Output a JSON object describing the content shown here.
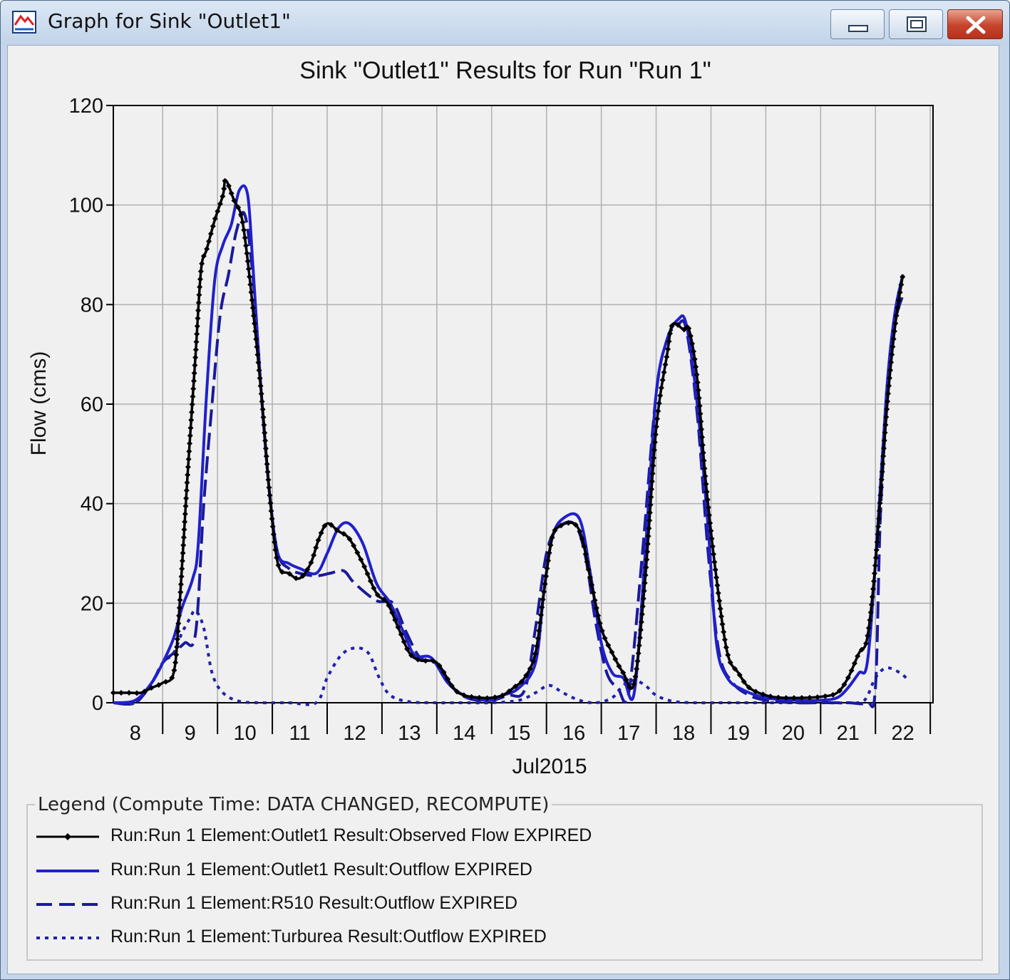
{
  "window": {
    "title": "Graph for Sink \"Outlet1\"",
    "icon": "hec-hms-app-icon",
    "controls": [
      "minimize-icon",
      "maximize-icon",
      "close-icon"
    ],
    "colors": {
      "close": "#c5432c",
      "frame": "#c5d6ea"
    }
  },
  "chart_data": {
    "type": "line",
    "title": "Sink \"Outlet1\" Results for Run \"Run 1\"",
    "xlabel": "Jul2015",
    "ylabel": "Flow (cms)",
    "xlim": [
      7.6,
      22.55
    ],
    "ylim": [
      0,
      120
    ],
    "yticks": [
      0,
      20,
      40,
      60,
      80,
      100,
      120
    ],
    "xtick_labels": [
      "8",
      "9",
      "10",
      "11",
      "12",
      "13",
      "14",
      "15",
      "16",
      "17",
      "18",
      "19",
      "20",
      "21",
      "22"
    ],
    "x_unit": "day of July 2015",
    "grid": true,
    "legend_placement": "bottom",
    "series": [
      {
        "name": "Run:Run 1 Element:Outlet1 Result:Observed Flow EXPIRED",
        "color": "#000000",
        "style": "solid-markers",
        "points": [
          [
            7.6,
            2
          ],
          [
            7.9,
            2
          ],
          [
            8.1,
            2
          ],
          [
            8.3,
            3
          ],
          [
            8.5,
            4
          ],
          [
            8.7,
            6
          ],
          [
            8.8,
            18
          ],
          [
            8.95,
            45
          ],
          [
            9.1,
            70
          ],
          [
            9.2,
            87
          ],
          [
            9.3,
            91
          ],
          [
            9.45,
            97
          ],
          [
            9.6,
            102
          ],
          [
            9.65,
            105
          ],
          [
            9.8,
            101
          ],
          [
            9.95,
            97
          ],
          [
            10.1,
            84
          ],
          [
            10.3,
            62
          ],
          [
            10.45,
            42
          ],
          [
            10.6,
            28
          ],
          [
            10.8,
            26
          ],
          [
            11.0,
            25
          ],
          [
            11.2,
            28
          ],
          [
            11.35,
            33
          ],
          [
            11.5,
            36
          ],
          [
            11.7,
            34.5
          ],
          [
            11.9,
            33
          ],
          [
            12.15,
            28
          ],
          [
            12.4,
            22
          ],
          [
            12.6,
            20
          ],
          [
            12.8,
            15
          ],
          [
            13.0,
            10
          ],
          [
            13.2,
            8.5
          ],
          [
            13.5,
            8
          ],
          [
            13.8,
            3
          ],
          [
            14.0,
            1.5
          ],
          [
            14.3,
            1
          ],
          [
            14.5,
            1
          ],
          [
            14.7,
            1.5
          ],
          [
            14.9,
            3
          ],
          [
            15.1,
            5
          ],
          [
            15.3,
            10
          ],
          [
            15.45,
            22
          ],
          [
            15.6,
            33
          ],
          [
            15.75,
            35.5
          ],
          [
            16.0,
            36
          ],
          [
            16.15,
            33
          ],
          [
            16.3,
            25
          ],
          [
            16.5,
            15
          ],
          [
            16.7,
            10
          ],
          [
            16.9,
            6
          ],
          [
            17.1,
            4
          ],
          [
            17.3,
            25
          ],
          [
            17.5,
            55
          ],
          [
            17.7,
            70
          ],
          [
            17.8,
            76
          ],
          [
            18.0,
            75
          ],
          [
            18.1,
            75
          ],
          [
            18.25,
            65
          ],
          [
            18.4,
            45
          ],
          [
            18.6,
            25
          ],
          [
            18.8,
            10
          ],
          [
            19.0,
            6
          ],
          [
            19.2,
            3
          ],
          [
            19.5,
            1.5
          ],
          [
            19.8,
            1
          ],
          [
            20.2,
            1
          ],
          [
            20.5,
            1.2
          ],
          [
            20.8,
            2
          ],
          [
            21.0,
            5
          ],
          [
            21.2,
            10
          ],
          [
            21.35,
            13
          ],
          [
            21.5,
            28
          ],
          [
            21.7,
            58
          ],
          [
            21.85,
            75
          ],
          [
            22.0,
            86
          ]
        ]
      },
      {
        "name": "Run:Run 1 Element:Outlet1 Result:Outflow EXPIRED",
        "color": "#2020cc",
        "style": "solid",
        "points": [
          [
            7.6,
            0
          ],
          [
            8.0,
            0.5
          ],
          [
            8.3,
            4
          ],
          [
            8.5,
            8
          ],
          [
            8.7,
            13
          ],
          [
            8.85,
            19
          ],
          [
            9.05,
            25
          ],
          [
            9.15,
            32
          ],
          [
            9.3,
            62
          ],
          [
            9.45,
            85
          ],
          [
            9.6,
            92
          ],
          [
            9.75,
            96
          ],
          [
            9.9,
            103
          ],
          [
            10.05,
            102
          ],
          [
            10.15,
            87
          ],
          [
            10.3,
            62
          ],
          [
            10.45,
            42
          ],
          [
            10.6,
            30
          ],
          [
            10.8,
            28
          ],
          [
            11.0,
            27
          ],
          [
            11.3,
            26
          ],
          [
            11.5,
            30
          ],
          [
            11.7,
            35
          ],
          [
            11.9,
            36
          ],
          [
            12.15,
            32
          ],
          [
            12.4,
            24
          ],
          [
            12.65,
            20
          ],
          [
            12.9,
            14
          ],
          [
            13.1,
            9.5
          ],
          [
            13.4,
            9
          ],
          [
            13.7,
            4
          ],
          [
            14.0,
            1.5
          ],
          [
            14.4,
            0.5
          ],
          [
            14.7,
            1.5
          ],
          [
            15.0,
            3
          ],
          [
            15.3,
            8
          ],
          [
            15.45,
            22
          ],
          [
            15.6,
            33
          ],
          [
            15.8,
            37
          ],
          [
            16.1,
            37
          ],
          [
            16.3,
            26
          ],
          [
            16.5,
            12
          ],
          [
            16.7,
            6
          ],
          [
            16.9,
            5
          ],
          [
            17.1,
            2
          ],
          [
            17.3,
            30
          ],
          [
            17.5,
            62
          ],
          [
            17.7,
            73
          ],
          [
            17.9,
            77
          ],
          [
            18.05,
            76
          ],
          [
            18.25,
            60
          ],
          [
            18.45,
            35
          ],
          [
            18.6,
            12
          ],
          [
            18.8,
            5
          ],
          [
            19.1,
            2.5
          ],
          [
            19.5,
            1
          ],
          [
            20.0,
            0.5
          ],
          [
            20.5,
            0.5
          ],
          [
            20.8,
            1
          ],
          [
            21.0,
            3
          ],
          [
            21.2,
            6
          ],
          [
            21.35,
            8
          ],
          [
            21.5,
            28
          ],
          [
            21.7,
            62
          ],
          [
            21.85,
            78
          ],
          [
            22.0,
            86
          ]
        ]
      },
      {
        "name": "Run:Run 1 Element:R510 Result:Outflow EXPIRED",
        "color": "#1a1a9a",
        "style": "dashed",
        "points": [
          [
            7.6,
            0
          ],
          [
            8.0,
            0
          ],
          [
            8.3,
            4
          ],
          [
            8.5,
            8
          ],
          [
            8.7,
            10
          ],
          [
            8.9,
            12
          ],
          [
            9.1,
            14
          ],
          [
            9.25,
            40
          ],
          [
            9.4,
            60
          ],
          [
            9.55,
            78
          ],
          [
            9.7,
            86
          ],
          [
            9.85,
            95
          ],
          [
            10.0,
            98
          ],
          [
            10.15,
            85
          ],
          [
            10.3,
            62
          ],
          [
            10.45,
            42
          ],
          [
            10.6,
            30
          ],
          [
            10.8,
            27
          ],
          [
            11.0,
            26
          ],
          [
            11.3,
            25.5
          ],
          [
            11.55,
            26
          ],
          [
            11.8,
            26.5
          ],
          [
            12.0,
            24
          ],
          [
            12.4,
            20.5
          ],
          [
            12.7,
            20
          ],
          [
            12.95,
            14
          ],
          [
            13.2,
            9
          ],
          [
            13.5,
            8
          ],
          [
            13.8,
            3
          ],
          [
            14.1,
            0.8
          ],
          [
            14.5,
            0.5
          ],
          [
            14.8,
            1.5
          ],
          [
            15.1,
            2.5
          ],
          [
            15.3,
            15
          ],
          [
            15.5,
            30
          ],
          [
            15.7,
            35
          ],
          [
            16.0,
            36
          ],
          [
            16.2,
            30
          ],
          [
            16.4,
            16
          ],
          [
            16.6,
            6
          ],
          [
            16.8,
            3
          ],
          [
            17.0,
            2
          ],
          [
            17.25,
            30
          ],
          [
            17.5,
            62
          ],
          [
            17.7,
            73
          ],
          [
            17.9,
            76
          ],
          [
            18.05,
            75
          ],
          [
            18.25,
            58
          ],
          [
            18.45,
            30
          ],
          [
            18.65,
            10
          ],
          [
            18.9,
            4
          ],
          [
            19.2,
            1.5
          ],
          [
            19.5,
            0.5
          ],
          [
            20.0,
            0
          ],
          [
            20.5,
            0
          ],
          [
            21.0,
            0
          ],
          [
            21.35,
            0
          ],
          [
            21.5,
            3
          ],
          [
            21.6,
            40
          ],
          [
            21.8,
            72
          ],
          [
            22.0,
            82
          ]
        ]
      },
      {
        "name": "Run:Run 1 Element:Turburea Result:Outflow EXPIRED",
        "color": "#2020aa",
        "style": "dotted",
        "points": [
          [
            7.6,
            0
          ],
          [
            8.0,
            0
          ],
          [
            8.3,
            4
          ],
          [
            8.5,
            8
          ],
          [
            8.7,
            10
          ],
          [
            8.85,
            14
          ],
          [
            9.0,
            17
          ],
          [
            9.1,
            18.5
          ],
          [
            9.25,
            15
          ],
          [
            9.4,
            6
          ],
          [
            9.6,
            2
          ],
          [
            9.9,
            0.3
          ],
          [
            10.3,
            0
          ],
          [
            10.8,
            0
          ],
          [
            11.3,
            0
          ],
          [
            11.5,
            5
          ],
          [
            11.75,
            9.5
          ],
          [
            12.0,
            11
          ],
          [
            12.25,
            10
          ],
          [
            12.45,
            5
          ],
          [
            12.65,
            1.5
          ],
          [
            13.0,
            0.2
          ],
          [
            13.5,
            0
          ],
          [
            14.0,
            0
          ],
          [
            14.5,
            0
          ],
          [
            15.0,
            0.5
          ],
          [
            15.3,
            2
          ],
          [
            15.55,
            3.5
          ],
          [
            15.8,
            2
          ],
          [
            16.1,
            0.5
          ],
          [
            16.4,
            0
          ],
          [
            16.7,
            1
          ],
          [
            16.9,
            3.5
          ],
          [
            17.1,
            4.5
          ],
          [
            17.3,
            3.5
          ],
          [
            17.5,
            1.5
          ],
          [
            17.8,
            0.3
          ],
          [
            18.2,
            0
          ],
          [
            18.8,
            0
          ],
          [
            19.5,
            0
          ],
          [
            20.0,
            0
          ],
          [
            20.5,
            0
          ],
          [
            21.0,
            0
          ],
          [
            21.3,
            0.5
          ],
          [
            21.5,
            5
          ],
          [
            21.7,
            7
          ],
          [
            21.95,
            6
          ],
          [
            22.1,
            4.5
          ]
        ]
      }
    ]
  },
  "legend": {
    "title": "Legend (Compute Time: DATA CHANGED, RECOMPUTE)",
    "items": [
      {
        "label": "Run:Run 1 Element:Outlet1 Result:Observed Flow EXPIRED",
        "color": "#000000",
        "style": "solid-markers"
      },
      {
        "label": "Run:Run 1 Element:Outlet1 Result:Outflow EXPIRED",
        "color": "#2020cc",
        "style": "solid"
      },
      {
        "label": "Run:Run 1 Element:R510 Result:Outflow EXPIRED",
        "color": "#1a1a9a",
        "style": "dashed"
      },
      {
        "label": "Run:Run 1 Element:Turburea Result:Outflow EXPIRED",
        "color": "#2020aa",
        "style": "dotted"
      }
    ]
  }
}
